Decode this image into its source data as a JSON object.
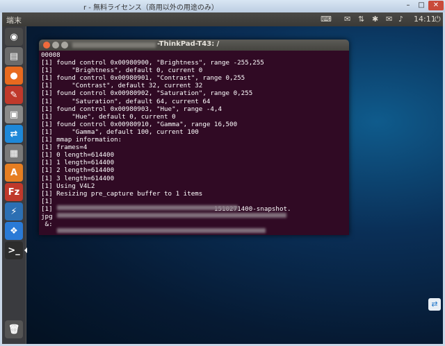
{
  "window": {
    "title": "r - 無料ライセンス（商用以外の用途のみ）",
    "minimize": "–",
    "maximize": "□",
    "close": "✕"
  },
  "panel": {
    "app_title": "端末",
    "time": "14:11",
    "icons": [
      "keyboard-icon",
      "envelope-icon",
      "network-icon",
      "bluetooth-icon",
      "mail-icon",
      "volume-icon",
      "power-icon"
    ]
  },
  "terminal": {
    "title": "-ThinkPad-T43: /",
    "lines": [
      "00008",
      "[1] found control 0x00980900, \"Brightness\", range -255,255",
      "[1]     \"Brightness\", default 0, current 0",
      "[1] found control 0x00980901, \"Contrast\", range 0,255",
      "[1]     \"Contrast\", default 32, current 32",
      "[1] found control 0x00980902, \"Saturation\", range 0,255",
      "[1]     \"Saturation\", default 64, current 64",
      "[1] found control 0x00980903, \"Hue\", range -4,4",
      "[1]     \"Hue\", default 0, current 0",
      "[1] found control 0x00980910, \"Gamma\", range 16,500",
      "[1]     \"Gamma\", default 100, current 100",
      "[1] mmap information:",
      "[1] frames=4",
      "[1] 0 length=614400",
      "[1] 1 length=614400",
      "[1] 2 length=614400",
      "[1] 3 length=614400",
      "[1] Using V4L2",
      "[1] Resizing pre_capture buffer to 1 items",
      "[1]",
      "[1]                                          1510271400-snapshot.",
      "jpg",
      " &:"
    ]
  },
  "launcher": {
    "items": [
      {
        "name": "dash-icon",
        "glyph": "◉",
        "bg": "#4a4a4a"
      },
      {
        "name": "files-icon",
        "glyph": "▤",
        "bg": "#6b6b6b"
      },
      {
        "name": "firefox-icon",
        "glyph": "●",
        "bg": "#e86a1f"
      },
      {
        "name": "settings-icon",
        "glyph": "✎",
        "bg": "#c0392b"
      },
      {
        "name": "image-viewer-icon",
        "glyph": "▣",
        "bg": "#8a8a8a"
      },
      {
        "name": "teamviewer-icon",
        "glyph": "⇄",
        "bg": "#1e88d8"
      },
      {
        "name": "screenshot-icon",
        "glyph": "▦",
        "bg": "#7a7a7a"
      },
      {
        "name": "software-center-icon",
        "glyph": "A",
        "bg": "#e67e22"
      },
      {
        "name": "filezilla-icon",
        "glyph": "Fz",
        "bg": "#c0392b"
      },
      {
        "name": "tools-icon",
        "glyph": "⚡",
        "bg": "#2c6fb3"
      },
      {
        "name": "dropbox-icon",
        "glyph": "❖",
        "bg": "#2a7ad6"
      },
      {
        "name": "terminal-icon",
        "glyph": ">_",
        "bg": "#2d2d2d"
      },
      {
        "name": "trash-icon",
        "glyph": "🗑",
        "bg": "#555555"
      }
    ]
  },
  "tray": {
    "glyph": "⇄"
  }
}
